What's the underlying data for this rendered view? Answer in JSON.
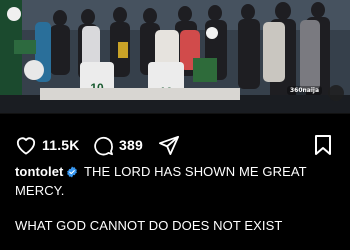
{
  "post": {
    "image_alt": "group-photo",
    "watermark": "360naija",
    "mute_icon": "speaker-muted-icon"
  },
  "actions": {
    "likes": "11.5K",
    "comments": "389",
    "like_icon": "heart-icon",
    "comment_icon": "comment-bubble-icon",
    "share_icon": "send-icon",
    "bookmark_icon": "bookmark-icon"
  },
  "caption": {
    "username": "tontolet",
    "text": "THE LORD HAS SHOWN ME GREAT MERCY.",
    "line2": "WHAT GOD CANNOT DO DOES NOT EXIST"
  },
  "colors": {
    "background": "#000000",
    "text": "#ffffff",
    "verified": "#3897f0"
  }
}
